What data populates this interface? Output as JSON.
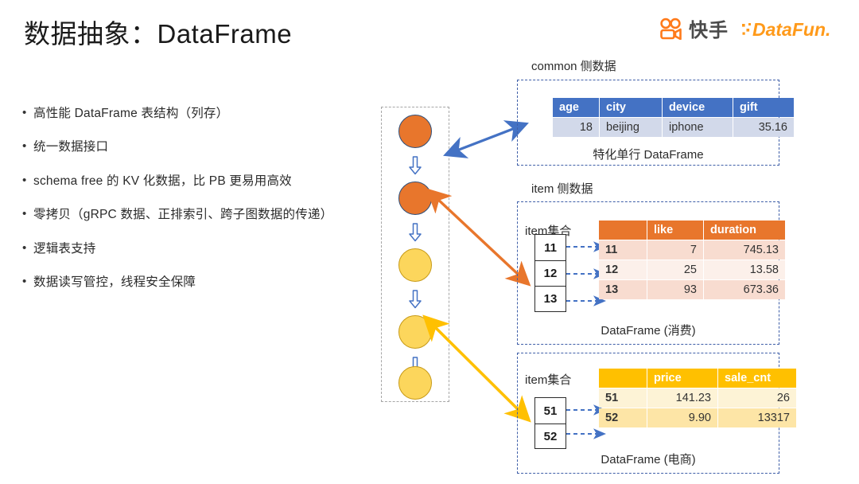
{
  "slide": {
    "title": "数据抽象：DataFrame"
  },
  "brand": {
    "kuaishou_name": "快手",
    "kuaishou_icon": "kuaishou-camera-icon",
    "datafun_name": "DataFun.",
    "datafun_icon": "datafun-logo-icon",
    "orange": "#FF7A1A",
    "gray": "#4a4a4a"
  },
  "bullets": [
    {
      "text": "高性能 DataFrame 表结构（列存）"
    },
    {
      "text": "统一数据接口"
    },
    {
      "text": "schema free 的 KV 化数据，比 PB 更易用高效"
    },
    {
      "text": "零拷贝（gRPC 数据、正排索引、跨子图数据的传递）"
    },
    {
      "text": "逻辑表支持"
    },
    {
      "text": "数据读写管控，线程安全保障"
    }
  ],
  "pipeline": {
    "nodes": [
      {
        "color": "#e8762c",
        "kind": "orange"
      },
      {
        "color": "#e8762c",
        "kind": "orange"
      },
      {
        "color": "#fcd65c",
        "kind": "yellow"
      },
      {
        "color": "#fcd65c",
        "kind": "yellow"
      },
      {
        "color": "#fcd65c",
        "kind": "yellow"
      }
    ],
    "flow_arrow_icon": "down-block-arrow-icon",
    "flow_arrow_color": "#4472c4"
  },
  "connectors": [
    {
      "name": "common-link",
      "color": "#4472c4"
    },
    {
      "name": "item-consume-link",
      "color": "#e8762c"
    },
    {
      "name": "item-ecom-link",
      "color": "#ffc000"
    }
  ],
  "panels": {
    "common": {
      "caption": "common 侧数据",
      "table_caption": "特化单行 DataFrame",
      "columns": [
        "age",
        "city",
        "device",
        "gift"
      ],
      "rows": [
        [
          "18",
          "beijing",
          "iphone",
          "35.16"
        ]
      ],
      "header_color": "#4472c4",
      "row_color": "#d2d9ea"
    },
    "item": {
      "caption": "item 侧数据",
      "consume": {
        "set_label": "item集合",
        "set_items": [
          "11",
          "12",
          "13"
        ],
        "table_caption": "DataFrame (消费)",
        "columns": [
          "",
          "like",
          "duration"
        ],
        "rows": [
          [
            "11",
            "7",
            "745.13"
          ],
          [
            "12",
            "25",
            "13.58"
          ],
          [
            "13",
            "93",
            "673.36"
          ]
        ],
        "header_color": "#e8762c"
      },
      "ecom": {
        "set_label": "item集合",
        "set_items": [
          "51",
          "52"
        ],
        "table_caption": "DataFrame (电商)",
        "columns": [
          "",
          "price",
          "sale_cnt"
        ],
        "rows": [
          [
            "51",
            "141.23",
            "26"
          ],
          [
            "52",
            "9.90",
            "13317"
          ]
        ],
        "header_color": "#ffc000"
      }
    }
  }
}
